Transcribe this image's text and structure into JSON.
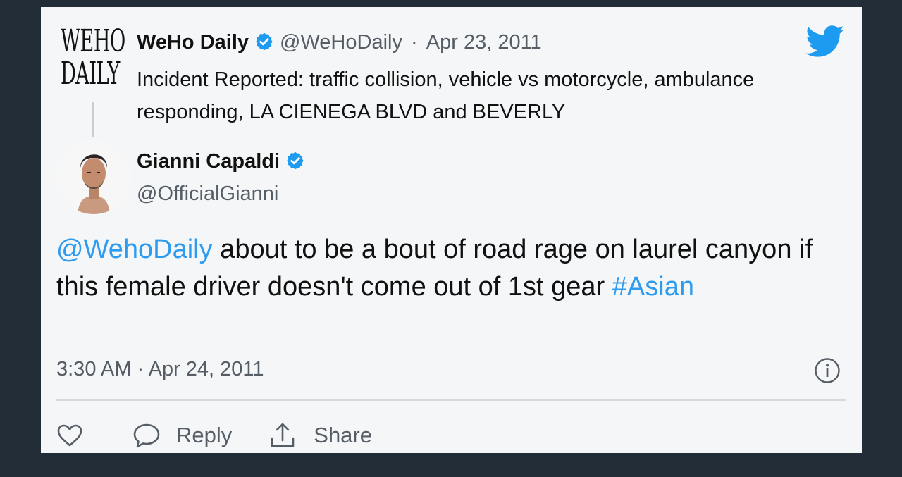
{
  "parent_tweet": {
    "logo_lines": [
      "WEHO",
      "DAILY"
    ],
    "author_name": "WeHo Daily",
    "handle": "@WeHoDaily",
    "separator": "·",
    "date": "Apr 23, 2011",
    "text": "Incident Reported: traffic collision, vehicle vs motorcycle, ambulance responding, LA CIENEGA BLVD and BEVERLY"
  },
  "tweet": {
    "author_name": "Gianni Capaldi",
    "handle": "@OfficialGianni",
    "mention": "@WehoDaily",
    "text": " about to be a bout of road rage on laurel canyon if this female driver doesn't come out of 1st gear ",
    "hashtag": "#Asian",
    "timestamp": "3:30 AM · Apr 24, 2011"
  },
  "actions": {
    "reply_label": "Reply",
    "share_label": "Share"
  },
  "colors": {
    "background": "#222c37",
    "card": "#f5f6f7",
    "link": "#2d9cf0",
    "verified": "#1d9bf0",
    "twitter_blue": "#1d9bf0"
  },
  "icons": [
    "verified-badge-icon",
    "twitter-bird-icon",
    "info-icon",
    "heart-icon",
    "reply-bubble-icon",
    "share-icon"
  ]
}
